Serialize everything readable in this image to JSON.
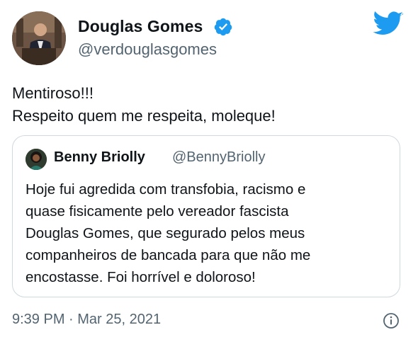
{
  "author": {
    "name": "Douglas Gomes",
    "handle": "@verdouglasgomes"
  },
  "tweet": {
    "lines": [
      "Mentiroso!!!",
      "Respeito quem me respeita, moleque!"
    ]
  },
  "quoted": {
    "name": "Benny Briolly",
    "handle": "@BennyBriolly",
    "lines": [
      "Hoje fui agredida com transfobia, racismo e",
      "quase fisicamente pelo vereador fascista",
      "Douglas Gomes, que segurado pelos meus",
      "companheiros de bancada para que não me",
      "encostasse. Foi horrível e doloroso!"
    ]
  },
  "timestamp": "9:39 PM · Mar 25, 2021",
  "colors": {
    "brand_blue": "#1d9bf0",
    "text_primary": "#0f1419",
    "text_secondary": "#536471",
    "border": "#cfd9de"
  },
  "icons": {
    "verified": "verified-badge-icon",
    "logo": "twitter-bird-icon",
    "info": "info-icon"
  }
}
